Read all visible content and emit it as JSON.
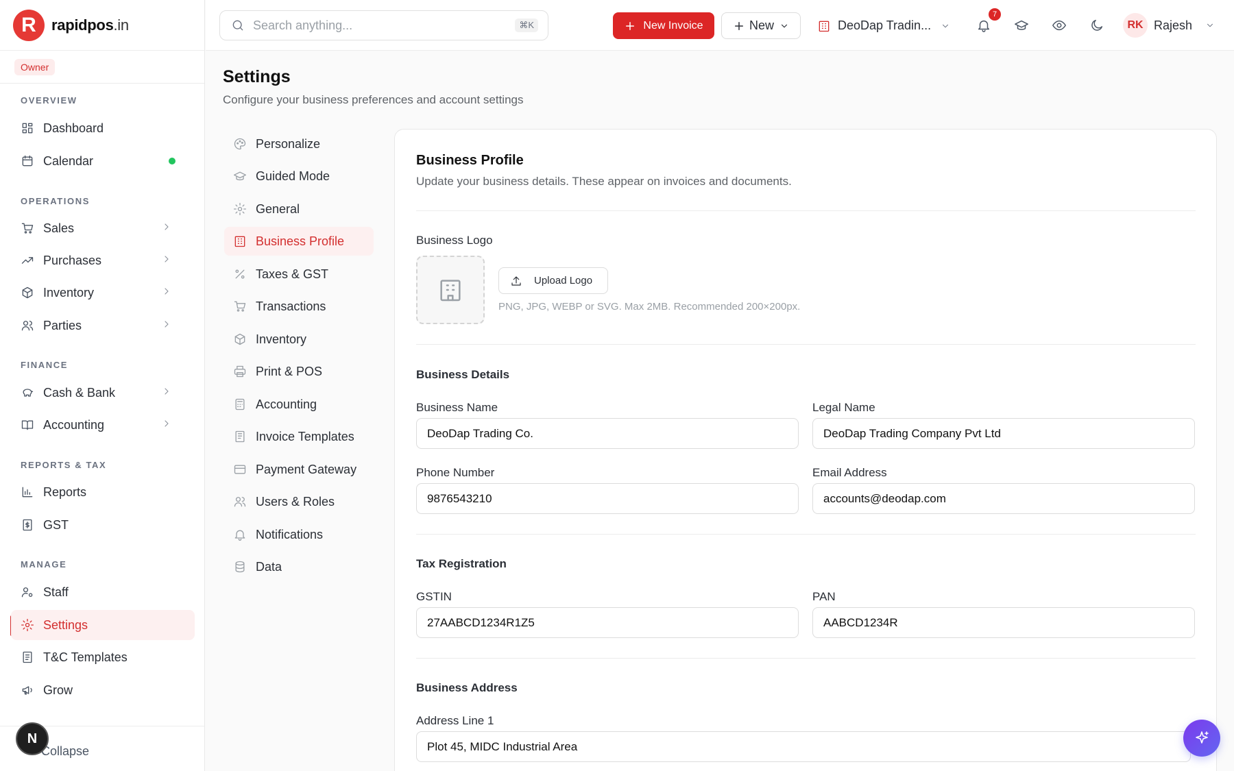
{
  "brand": {
    "mark": "R",
    "name": "rapidpos",
    "tld": ".in"
  },
  "role": "Owner",
  "sidebar": {
    "sections": {
      "overview": "OVERVIEW",
      "operations": "OPERATIONS",
      "finance": "FINANCE",
      "reports": "REPORTS & TAX",
      "manage": "MANAGE"
    },
    "items": {
      "dashboard": "Dashboard",
      "calendar": "Calendar",
      "sales": "Sales",
      "purchases": "Purchases",
      "inventory": "Inventory",
      "parties": "Parties",
      "cash_bank": "Cash & Bank",
      "accounting": "Accounting",
      "reports": "Reports",
      "gst": "GST",
      "staff": "Staff",
      "settings": "Settings",
      "tc_templates": "T&C Templates",
      "grow": "Grow"
    },
    "collapse": "Collapse",
    "user_initial": "N"
  },
  "topbar": {
    "search_placeholder": "Search anything...",
    "search_shortcut": "⌘K",
    "new_invoice": "New Invoice",
    "new": "New",
    "company": "DeoDap Tradin...",
    "notification_count": "7",
    "user_initials": "RK",
    "user_name": "Rajesh"
  },
  "page": {
    "title": "Settings",
    "subtitle": "Configure your business preferences and account settings"
  },
  "settings_menu": {
    "personalize": "Personalize",
    "guided_mode": "Guided Mode",
    "general": "General",
    "business_profile": "Business Profile",
    "taxes_gst": "Taxes & GST",
    "transactions": "Transactions",
    "inventory": "Inventory",
    "print_pos": "Print & POS",
    "accounting": "Accounting",
    "invoice_templates": "Invoice Templates",
    "payment_gateway": "Payment Gateway",
    "users_roles": "Users & Roles",
    "notifications": "Notifications",
    "data": "Data"
  },
  "profile": {
    "title": "Business Profile",
    "subtitle": "Update your business details. These appear on invoices and documents.",
    "logo_label": "Business Logo",
    "upload_label": "Upload Logo",
    "logo_hint": "PNG, JPG, WEBP or SVG. Max 2MB. Recommended 200×200px.",
    "details_heading": "Business Details",
    "business_name_label": "Business Name",
    "business_name": "DeoDap Trading Co.",
    "legal_name_label": "Legal Name",
    "legal_name": "DeoDap Trading Company Pvt Ltd",
    "phone_label": "Phone Number",
    "phone": "9876543210",
    "email_label": "Email Address",
    "email": "accounts@deodap.com",
    "tax_heading": "Tax Registration",
    "gstin_label": "GSTIN",
    "gstin": "27AABCD1234R1Z5",
    "pan_label": "PAN",
    "pan": "AABCD1234R",
    "address_heading": "Business Address",
    "address1_label": "Address Line 1",
    "address1": "Plot 45, MIDC Industrial Area"
  },
  "colors": {
    "accent": "#dc2626",
    "active_bg": "#fdf0f0",
    "status_green": "#22c55e"
  },
  "icons": [
    "search-icon",
    "plus-icon",
    "bell-icon",
    "graduation-cap-icon",
    "eye-icon",
    "moon-icon",
    "building-icon",
    "chevron-down-icon",
    "chevron-right-icon",
    "sparkle-icon"
  ]
}
